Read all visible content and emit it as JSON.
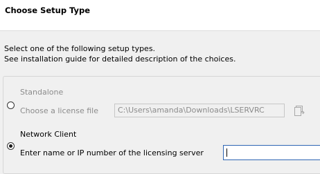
{
  "header": {
    "title": "Choose Setup Type"
  },
  "intro": {
    "line1": "Select one of the following setup types.",
    "line2": "See installation guide for detailed description of the choices."
  },
  "options": {
    "standalone": {
      "label": "Standalone",
      "selected": false,
      "file_label": "Choose a license file",
      "file_value": "C:\\Users\\amanda\\Downloads\\LSERVRC",
      "browse_icon": "folder-browse-icon"
    },
    "network": {
      "label": "Network Client",
      "selected": true,
      "server_label": "Enter name or IP number of the licensing server",
      "server_value": ""
    }
  },
  "colors": {
    "header_bg": "#ffffff",
    "window_bg": "#f0f0f0",
    "disabled_text": "#8b8b8b",
    "focus_border": "#2d64b3"
  }
}
